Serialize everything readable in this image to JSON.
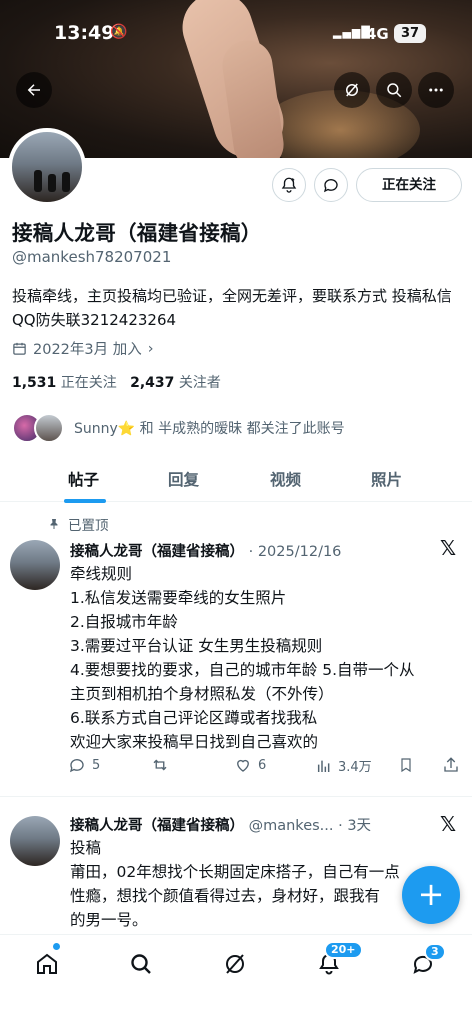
{
  "status_bar": {
    "time": "13:49",
    "network": "4G",
    "battery": "37"
  },
  "profile": {
    "name": "接稿人龙哥（福建省接稿）",
    "handle": "@mankesh78207021",
    "bio": "投稿牵线，主页投稿均已验证，全网无差评，要联系方式 投稿私信 QQ防失联3212423264",
    "joined": "2022年3月 加入",
    "following_count": "1,531",
    "following_label": "正在关注",
    "followers_count": "2,437",
    "followers_label": "关注者",
    "followed_by_text": "Sunny⭐ 和 半成熟的暧昧 都关注了此账号",
    "follow_button": "正在关注"
  },
  "tabs": [
    {
      "label": "帖子",
      "active": true
    },
    {
      "label": "回复",
      "active": false
    },
    {
      "label": "视频",
      "active": false
    },
    {
      "label": "照片",
      "active": false
    }
  ],
  "posts": [
    {
      "pinned_label": "已置顶",
      "author": "接稿人龙哥（福建省接稿）",
      "meta": "· 2025/12/16",
      "lines": [
        "牵线规则",
        " 1.私信发送需要牵线的女生照片",
        " 2.自报城市年龄",
        "  3.需要过平台认证 女生男生投稿规则",
        " 4.要想要找的要求，自己的城市年龄 5.自带一个从",
        "主页到相机拍个身材照私发（不外传）",
        "6.联系方式自己评论区蹲或者找我私",
        "欢迎大家来投稿早日找到自己喜欢的"
      ],
      "replies": "5",
      "likes": "6",
      "views": "3.4万"
    },
    {
      "author": "接稿人龙哥（福建省接稿）",
      "meta": "@mankes... · 3天",
      "lines": [
        "投稿",
        "莆田，02年想找个长期固定床搭子，自己有一点",
        "性瘾，想找个颜值看得过去，身材好，跟我有",
        "的男一号。"
      ]
    }
  ],
  "nav": {
    "notifications_badge": "20+",
    "messages_badge": "3"
  },
  "colors": {
    "accent": "#1d9bf0",
    "text": "#0f1419",
    "muted": "#536471"
  }
}
